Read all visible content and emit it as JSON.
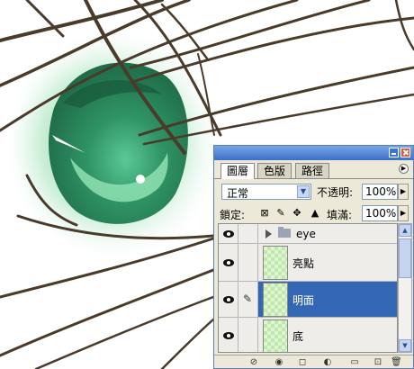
{
  "artwork": {
    "description_icon": "anime-eye-drawing",
    "iris_color": "#3a9a6a",
    "glow_color": "#7fd39f",
    "line_color": "#4a3a2a"
  },
  "palette": {
    "tabs": [
      {
        "label": "圖層",
        "active": true
      },
      {
        "label": "色版",
        "active": false
      },
      {
        "label": "路徑",
        "active": false
      }
    ],
    "blend_mode": "正常",
    "opacity_label": "不透明:",
    "opacity_value": "100%",
    "lock_label": "鎖定:",
    "fill_label": "填滿:",
    "fill_value": "100%",
    "layers": [
      {
        "name": "eye",
        "type": "group",
        "visible": true,
        "selected": false
      },
      {
        "name": "亮點",
        "type": "layer",
        "visible": true,
        "selected": false
      },
      {
        "name": "明面",
        "type": "layer",
        "visible": true,
        "selected": true
      },
      {
        "name": "底",
        "type": "layer",
        "visible": true,
        "selected": false
      }
    ],
    "selection_color": "#3366b3"
  }
}
